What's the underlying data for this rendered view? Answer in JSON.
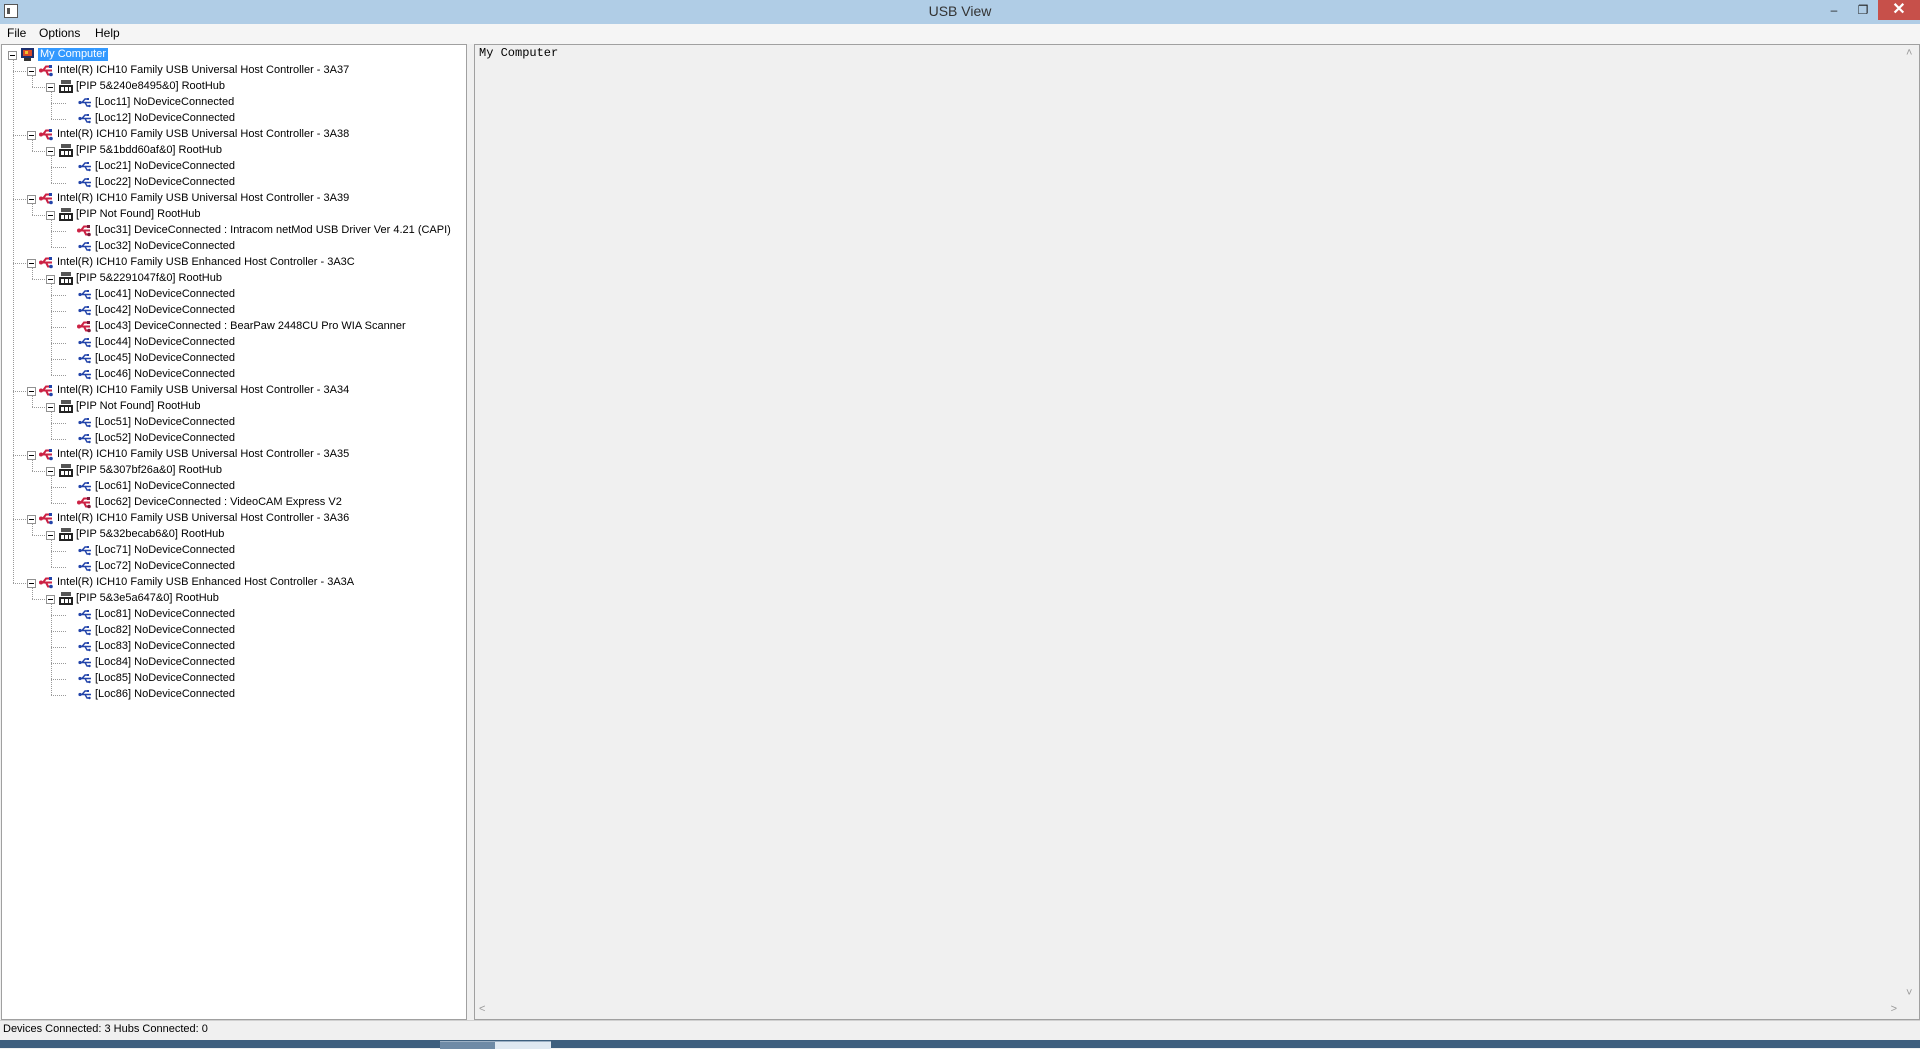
{
  "window": {
    "title": "USB View",
    "minimize": "–",
    "maximize": "❐",
    "close": "✕"
  },
  "menu": {
    "items": [
      "File",
      "Options",
      "Help"
    ]
  },
  "tree": [
    {
      "level": 0,
      "icon": "computer-icon",
      "label": "My Computer",
      "selected": true
    },
    {
      "level": 1,
      "icon": "usb-controller-icon",
      "label": "Intel(R) ICH10 Family USB Universal Host Controller - 3A37"
    },
    {
      "level": 2,
      "icon": "usb-hub-icon",
      "label": "[PIP 5&240e8495&0] RootHub"
    },
    {
      "level": 3,
      "icon": "usb-port-icon",
      "label": "[Loc11] NoDeviceConnected"
    },
    {
      "level": 3,
      "icon": "usb-port-icon",
      "label": "[Loc12] NoDeviceConnected"
    },
    {
      "level": 1,
      "icon": "usb-controller-icon",
      "label": "Intel(R) ICH10 Family USB Universal Host Controller - 3A38"
    },
    {
      "level": 2,
      "icon": "usb-hub-icon",
      "label": "[PIP 5&1bdd60af&0] RootHub"
    },
    {
      "level": 3,
      "icon": "usb-port-icon",
      "label": "[Loc21] NoDeviceConnected"
    },
    {
      "level": 3,
      "icon": "usb-port-icon",
      "label": "[Loc22] NoDeviceConnected"
    },
    {
      "level": 1,
      "icon": "usb-controller-icon",
      "label": "Intel(R) ICH10 Family USB Universal Host Controller - 3A39"
    },
    {
      "level": 2,
      "icon": "usb-hub-icon",
      "label": "[PIP Not Found] RootHub"
    },
    {
      "level": 3,
      "icon": "usb-device-icon",
      "label": "[Loc31] DeviceConnected :  Intracom netMod USB Driver Ver 4.21 (CAPI)"
    },
    {
      "level": 3,
      "icon": "usb-port-icon",
      "label": "[Loc32] NoDeviceConnected"
    },
    {
      "level": 1,
      "icon": "usb-controller-icon",
      "label": "Intel(R) ICH10 Family USB Enhanced Host Controller - 3A3C"
    },
    {
      "level": 2,
      "icon": "usb-hub-icon",
      "label": "[PIP 5&2291047f&0] RootHub"
    },
    {
      "level": 3,
      "icon": "usb-port-icon",
      "label": "[Loc41] NoDeviceConnected"
    },
    {
      "level": 3,
      "icon": "usb-port-icon",
      "label": "[Loc42] NoDeviceConnected"
    },
    {
      "level": 3,
      "icon": "usb-device-icon",
      "label": "[Loc43] DeviceConnected :  BearPaw 2448CU Pro WIA Scanner"
    },
    {
      "level": 3,
      "icon": "usb-port-icon",
      "label": "[Loc44] NoDeviceConnected"
    },
    {
      "level": 3,
      "icon": "usb-port-icon",
      "label": "[Loc45] NoDeviceConnected"
    },
    {
      "level": 3,
      "icon": "usb-port-icon",
      "label": "[Loc46] NoDeviceConnected"
    },
    {
      "level": 1,
      "icon": "usb-controller-icon",
      "label": "Intel(R) ICH10 Family USB Universal Host Controller - 3A34"
    },
    {
      "level": 2,
      "icon": "usb-hub-icon",
      "label": "[PIP Not Found] RootHub"
    },
    {
      "level": 3,
      "icon": "usb-port-icon",
      "label": "[Loc51] NoDeviceConnected"
    },
    {
      "level": 3,
      "icon": "usb-port-icon",
      "label": "[Loc52] NoDeviceConnected"
    },
    {
      "level": 1,
      "icon": "usb-controller-icon",
      "label": "Intel(R) ICH10 Family USB Universal Host Controller - 3A35"
    },
    {
      "level": 2,
      "icon": "usb-hub-icon",
      "label": "[PIP 5&307bf26a&0] RootHub"
    },
    {
      "level": 3,
      "icon": "usb-port-icon",
      "label": "[Loc61] NoDeviceConnected"
    },
    {
      "level": 3,
      "icon": "usb-device-icon",
      "label": "[Loc62] DeviceConnected :  VideoCAM Express V2"
    },
    {
      "level": 1,
      "icon": "usb-controller-icon",
      "label": "Intel(R) ICH10 Family USB Universal Host Controller - 3A36"
    },
    {
      "level": 2,
      "icon": "usb-hub-icon",
      "label": "[PIP 5&32becab6&0] RootHub"
    },
    {
      "level": 3,
      "icon": "usb-port-icon",
      "label": "[Loc71] NoDeviceConnected"
    },
    {
      "level": 3,
      "icon": "usb-port-icon",
      "label": "[Loc72] NoDeviceConnected"
    },
    {
      "level": 1,
      "icon": "usb-controller-icon",
      "label": "Intel(R) ICH10 Family USB Enhanced Host Controller - 3A3A"
    },
    {
      "level": 2,
      "icon": "usb-hub-icon",
      "label": "[PIP 5&3e5a647&0] RootHub"
    },
    {
      "level": 3,
      "icon": "usb-port-icon",
      "label": "[Loc81] NoDeviceConnected"
    },
    {
      "level": 3,
      "icon": "usb-port-icon",
      "label": "[Loc82] NoDeviceConnected"
    },
    {
      "level": 3,
      "icon": "usb-port-icon",
      "label": "[Loc83] NoDeviceConnected"
    },
    {
      "level": 3,
      "icon": "usb-port-icon",
      "label": "[Loc84] NoDeviceConnected"
    },
    {
      "level": 3,
      "icon": "usb-port-icon",
      "label": "[Loc85] NoDeviceConnected"
    },
    {
      "level": 3,
      "icon": "usb-port-icon",
      "label": "[Loc86] NoDeviceConnected"
    }
  ],
  "detail": {
    "text": "My Computer"
  },
  "status": {
    "text": "Devices Connected: 3   Hubs Connected: 0"
  },
  "colors": {
    "selection": "#3399ff",
    "titlebar": "#b0cde6",
    "close": "#c7504a",
    "usb_blue": "#2244aa",
    "usb_red": "#cc2244"
  }
}
